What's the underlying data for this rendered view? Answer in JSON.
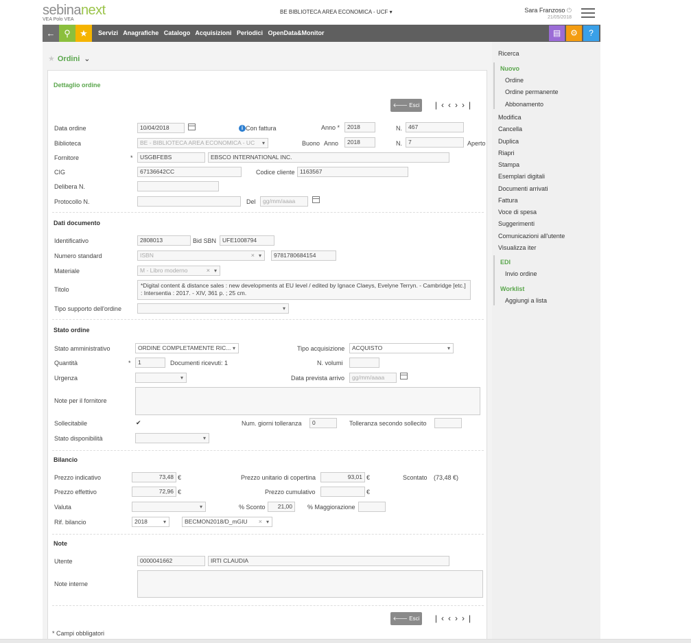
{
  "header": {
    "logo_prefix": "sebina",
    "logo_suffix": "next",
    "logo_sub": "VEA Polo VEA",
    "library": "BE BIBLIOTECA AREA ECONOMICA - UCF",
    "user": "Sara Franzoso",
    "date": "21/05/2018"
  },
  "nav": {
    "menu": [
      "Servizi",
      "Anagrafiche",
      "Catalogo",
      "Acquisizioni",
      "Periodici",
      "OpenData&Monitor"
    ]
  },
  "sidebar": {
    "items": [
      {
        "label": "Ricerca"
      },
      {
        "label": "Nuovo"
      },
      {
        "label": "Ordine"
      },
      {
        "label": "Ordine permanente"
      },
      {
        "label": "Abbonamento"
      },
      {
        "label": "Modifica"
      },
      {
        "label": "Cancella"
      },
      {
        "label": "Duplica"
      },
      {
        "label": "Riapri"
      },
      {
        "label": "Stampa"
      },
      {
        "label": "Esemplari digitali"
      },
      {
        "label": "Documenti arrivati"
      },
      {
        "label": "Fattura"
      },
      {
        "label": "Voce di spesa"
      },
      {
        "label": "Suggerimenti"
      },
      {
        "label": "Comunicazioni all'utente"
      },
      {
        "label": "Visualizza iter"
      },
      {
        "label": "EDI"
      },
      {
        "label": "Invio ordine"
      },
      {
        "label": "Worklist"
      },
      {
        "label": "Aggiungi a lista"
      }
    ]
  },
  "page": {
    "title": "Ordini",
    "card_title": "Dettaglio ordine",
    "esc_label": "Esci",
    "required_note": "* Campi obbligatori"
  },
  "order": {
    "data_ordine_label": "Data ordine",
    "data_ordine": "10/04/2018",
    "con_fattura": "Con fattura",
    "anno_label": "Anno *",
    "anno": "2018",
    "n_label": "N.",
    "n": "467",
    "biblioteca_label": "Biblioteca",
    "biblioteca": "BE - BIBLIOTECA AREA ECONOMICA - UC",
    "buono_label": "Buono",
    "buono_anno_label": "Anno",
    "buono_anno": "2018",
    "buono_n_label": "N.",
    "buono_n": "7",
    "aperto": "Aperto",
    "fornitore_label": "Fornitore",
    "required_mark": "*",
    "fornitore_code": "USGBFEBS",
    "fornitore_name": "EBSCO INTERNATIONAL INC.",
    "cig_label": "CIG",
    "cig": "67136642CC",
    "codice_cliente_label": "Codice cliente",
    "codice_cliente": "1163567",
    "delibera_label": "Delibera N.",
    "protocollo_label": "Protocollo N.",
    "del_label": "Del",
    "date_placeholder": "gg/mm/aaaa"
  },
  "documento": {
    "section": "Dati documento",
    "identificativo_label": "Identificativo",
    "identificativo": "2808013",
    "bid_label": "Bid SBN",
    "bid": "UFE1008794",
    "numero_label": "Numero standard",
    "numero_type": "ISBN",
    "numero": "9781780684154",
    "materiale_label": "Materiale",
    "materiale": "M - Libro moderno",
    "titolo_label": "Titolo",
    "titolo": "*Digital content & distance sales : new developments at EU level / edited by Ignace Claeys, Evelyne Terryn. - Cambridge [etc.] : Intersentia : 2017. - XIV, 361 p. ; 25 cm.",
    "supporto_label": "Tipo supporto dell'ordine"
  },
  "stato": {
    "section": "Stato ordine",
    "amministrativo_label": "Stato amministrativo",
    "amministrativo": "ORDINE COMPLETAMENTE RIC...",
    "tipo_acq_label": "Tipo acquisizione",
    "tipo_acq": "ACQUISTO",
    "quantita_label": "Quantità",
    "quantita": "1",
    "doc_ricevuti": "Documenti ricevuti: 1",
    "volumi_label": "N. volumi",
    "urgenza_label": "Urgenza",
    "data_prevista_label": "Data prevista arrivo",
    "note_fornitore_label": "Note per il fornitore",
    "sollecitabile_label": "Sollecitabile",
    "giorni_label": "Num. giorni tolleranza",
    "giorni": "0",
    "tolleranza_label": "Tolleranza secondo sollecito",
    "disponibilita_label": "Stato disponibilità"
  },
  "bilancio": {
    "section": "Bilancio",
    "prezzo_ind_label": "Prezzo indicativo",
    "prezzo_ind": "73,48",
    "euro": "€",
    "prezzo_cop_label": "Prezzo unitario di copertina",
    "prezzo_cop": "93,01",
    "scontato_label": "Scontato",
    "scontato": "(73,48 €)",
    "prezzo_eff_label": "Prezzo effettivo",
    "prezzo_eff": "72,96",
    "prezzo_cum_label": "Prezzo cumulativo",
    "valuta_label": "Valuta",
    "sconto_label": "% Sconto",
    "sconto": "21,00",
    "magg_label": "% Maggiorazione",
    "rif_label": "Rif. bilancio",
    "rif_anno": "2018",
    "rif_cap": "BECMON2018/D_mGIU"
  },
  "note": {
    "section": "Note",
    "utente_label": "Utente",
    "utente_code": "0000041662",
    "utente_name": "IRTI CLAUDIA",
    "interne_label": "Note interne"
  }
}
